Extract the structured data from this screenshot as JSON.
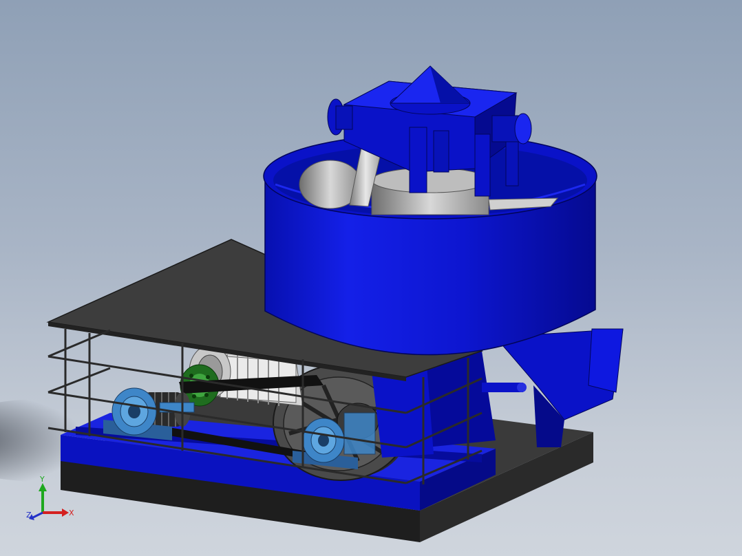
{
  "triad": {
    "x_label": "X",
    "y_label": "Y",
    "z_label": "Z",
    "colors": {
      "x": "#d42020",
      "y": "#1ea81e",
      "z": "#2230c8"
    }
  },
  "palette": {
    "accent_blue": "#0a10c8",
    "dark_blue": "#05087a",
    "deck_gray": "#4a4a4a",
    "base_black": "#1c1c1c",
    "bearing_blue": "#3e86c8",
    "coupling_green": "#2e8a2e",
    "drum_gray": "#9a9a9a"
  }
}
